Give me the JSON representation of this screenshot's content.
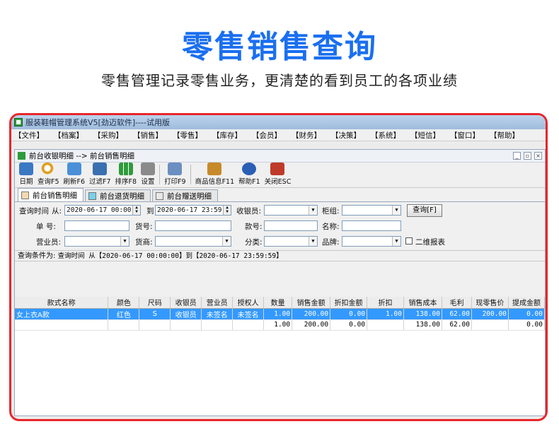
{
  "hero": {
    "title": "零售销售查询",
    "subtitle": "零售管理记录零售业务，更清楚的看到员工的各项业绩"
  },
  "window": {
    "title": "服装鞋帽管理系统V5[劲迈软件]----试用版"
  },
  "menu": [
    "【文件】",
    "【档案】",
    "【采购】",
    "【销售】",
    "【零售】",
    "【库存】",
    "【会员】",
    "【财务】",
    "【决策】",
    "【系统】",
    "【短信】",
    "【窗口】",
    "【帮助】"
  ],
  "subwindow": {
    "title": "前台收银明细 --> 前台销售明细"
  },
  "toolbar": [
    {
      "label": "日期",
      "icon": "calendar-icon",
      "color": "#3a78c2"
    },
    {
      "label": "查询F5",
      "icon": "magnifier-icon",
      "color": "#e0a020"
    },
    {
      "label": "刷新F6",
      "icon": "refresh-icon",
      "color": "#4a90d9"
    },
    {
      "label": "过滤F7",
      "icon": "filter-icon",
      "color": "#3a6fb0"
    },
    {
      "label": "排序F8",
      "icon": "sort-icon",
      "color": "#2e9b3a"
    },
    {
      "label": "设置",
      "icon": "settings-icon",
      "color": "#8a8a8a"
    },
    {
      "label": "打印F9",
      "icon": "printer-icon",
      "color": "#6a8fc0"
    },
    {
      "label": "商品信息F11",
      "icon": "package-icon",
      "color": "#c78a2a"
    },
    {
      "label": "帮助F1",
      "icon": "help-icon",
      "color": "#2a5fb5"
    },
    {
      "label": "关闭ESC",
      "icon": "exit-icon",
      "color": "#c03a2a"
    }
  ],
  "tabs": [
    "前台销售明细",
    "前台退货明细",
    "前台赠送明细"
  ],
  "form": {
    "query_time_label": "查询时间",
    "from_label": "从:",
    "from_value": "2020-06-17 00:00:00",
    "to_label": "到",
    "to_value": "2020-06-17 23:59:59",
    "cashier_label": "收银员:",
    "counter_label": "柜组:",
    "query_button": "查询[F]",
    "order_label": "单  号:",
    "goods_no_label": "货号:",
    "style_no_label": "款号:",
    "name_label": "名称:",
    "salesperson_label": "营业员:",
    "supplier_label": "货商:",
    "category_label": "分类:",
    "brand_label": "品牌:",
    "qr_label": "二维报表"
  },
  "condition": {
    "prefix": "查询条件为: ",
    "text": "查询时间 从【2020-06-17 00:00:00】到【2020-06-17 23:59:59】"
  },
  "table": {
    "columns": [
      "款式名称",
      "颜色",
      "尺码",
      "收银员",
      "营业员",
      "授权人",
      "数量",
      "销售金额",
      "折扣金额",
      "折扣",
      "销售成本",
      "毛利",
      "现零售价",
      "提成金额"
    ],
    "rows": [
      [
        "女上衣A款",
        "红色",
        "S",
        "收银员",
        "未签名",
        "未签名",
        "1.00",
        "200.00",
        "0.00",
        "1.00",
        "138.00",
        "62.00",
        "200.00",
        "0.00"
      ]
    ],
    "totals": [
      "",
      "",
      "",
      "",
      "",
      "",
      "1.00",
      "200.00",
      "0.00",
      "",
      "138.00",
      "62.00",
      "",
      "0.00"
    ]
  }
}
